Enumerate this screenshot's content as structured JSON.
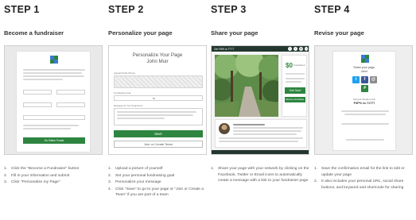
{
  "steps": [
    {
      "label": "STEP 1",
      "title": "Become a fundraiser",
      "items": [
        "Click the \"Become a Fundraiser\" button",
        "Fill in your information and submit",
        "Click \"Personalize my Page\""
      ],
      "screen": {
        "go_button": "Go Raise Funds"
      }
    },
    {
      "label": "STEP 2",
      "title": "Personalize your page",
      "items": [
        "Upload a picture of yourself",
        "Set your personal fundraising goal",
        "Personalize your message",
        "Click \"Save\" to go to your page or \"Join or Create a Team\" if you are part of a team"
      ],
      "screen": {
        "heading_line1": "Personalize Your Page",
        "heading_line2": "John Muir",
        "upload_label": "Upload Profile Picture",
        "goal_label": "Fundraising Goal",
        "goal_value": "50",
        "message_label": "Message for Your Supporters",
        "save_button": "Save",
        "team_button": "Join or Create Team"
      }
    },
    {
      "label": "STEP 3",
      "title": "Share your page",
      "items": [
        "Share your page with your network by clicking on the Facebook, Twitter or Email icons to automatically create a message with a link to your fundraiser page"
      ],
      "screen": {
        "site_name": "Get FitFit to TTTT",
        "raised_amount": "$0",
        "raised_label": "Total Raised",
        "donate_button": "Give Now!",
        "fundraiser_button": "Become a Fundraiser",
        "social_icons": [
          "twitter-icon",
          "facebook-icon",
          "email-icon",
          "link-icon"
        ]
      }
    },
    {
      "label": "STEP 4",
      "title": "Revise your page",
      "items": [
        "Save the confirmation email for the link to edit or update your page",
        "It also includes your personal URL, social share buttons, and keyword and shortcode for sharing"
      ],
      "screen": {
        "share_heading": "Share your page,",
        "share_name": "John!",
        "tell_friends": "Tell your friends to text",
        "keyword_line": "P3P% to 71777",
        "share_icons": [
          "twitter-icon",
          "facebook-icon",
          "email-icon",
          "sms-icon"
        ]
      }
    }
  ],
  "colors": {
    "brand_green": "#2e8540",
    "dark_header": "#23372f",
    "twitter": "#1da1f2",
    "facebook": "#3b5998",
    "email": "#8c8c8c"
  }
}
